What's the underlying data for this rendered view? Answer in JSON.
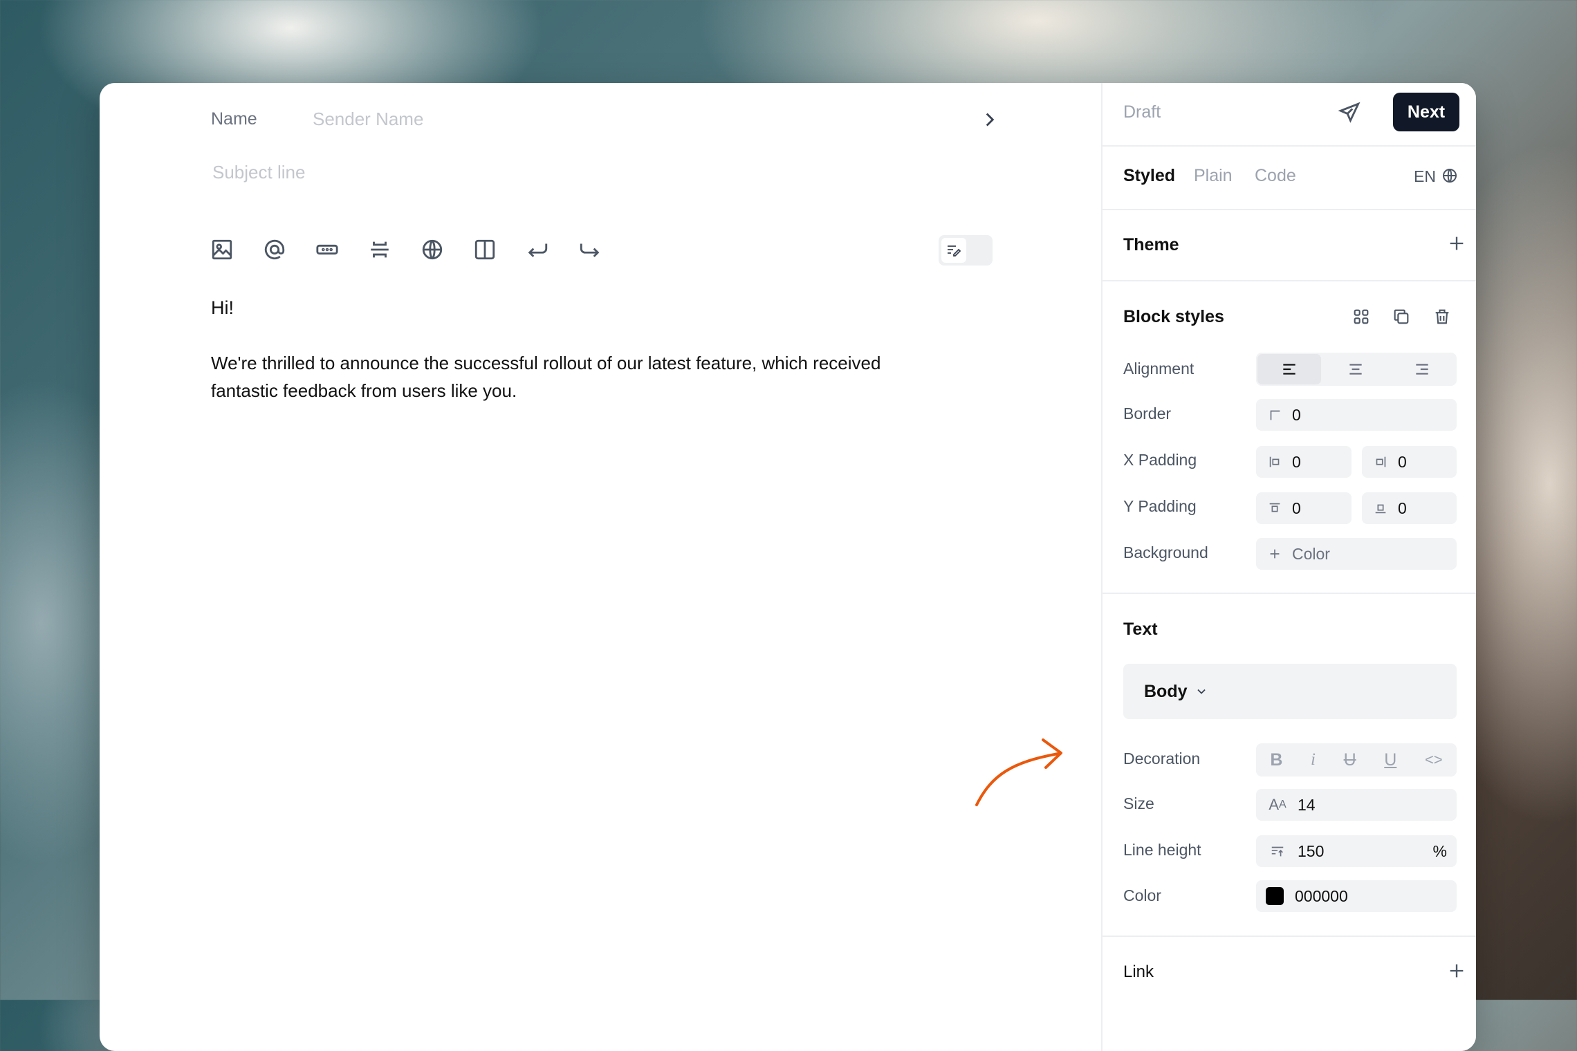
{
  "compose": {
    "name_label": "Name",
    "sender_placeholder": "Sender Name",
    "subject_placeholder": "Subject line"
  },
  "toolbar": {
    "icons": [
      "image-icon",
      "at-icon",
      "button-icon",
      "divider-icon",
      "globe-icon",
      "columns-icon",
      "undo-icon",
      "redo-icon"
    ]
  },
  "content": {
    "greeting": "Hi!",
    "paragraph_line1": "We're thrilled to announce the successful rollout of our latest feature, which received",
    "paragraph_line2": "fantastic feedback from users like you."
  },
  "header": {
    "status": "Draft",
    "next_label": "Next"
  },
  "tabs": {
    "styled": "Styled",
    "plain": "Plain",
    "code": "Code",
    "language": "EN"
  },
  "theme": {
    "title": "Theme"
  },
  "block_styles": {
    "title": "Block styles",
    "alignment_label": "Alignment",
    "border_label": "Border",
    "border_value": "0",
    "x_padding_label": "X Padding",
    "x_padding_left": "0",
    "x_padding_right": "0",
    "y_padding_label": "Y Padding",
    "y_padding_top": "0",
    "y_padding_bottom": "0",
    "background_label": "Background",
    "background_placeholder": "Color"
  },
  "text": {
    "title": "Text",
    "style_select": "Body",
    "decoration_label": "Decoration",
    "size_label": "Size",
    "size_value": "14",
    "line_height_label": "Line height",
    "line_height_value": "150",
    "line_height_unit": "%",
    "color_label": "Color",
    "color_value": "000000"
  },
  "link": {
    "title": "Link"
  },
  "colors": {
    "accent_button": "#111827",
    "arrow": "#ea580c",
    "swatch": "#000000"
  }
}
